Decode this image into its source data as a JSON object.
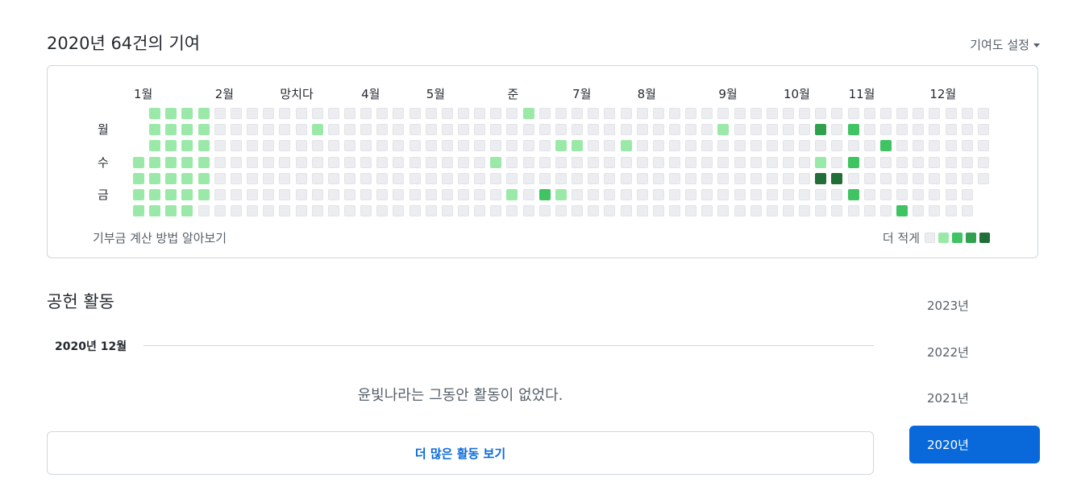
{
  "header": {
    "title": "2020년 64건의 기여",
    "settings_label": "기여도 설정"
  },
  "graph": {
    "months": [
      {
        "label": "1월",
        "col": 0
      },
      {
        "label": "2월",
        "col": 5
      },
      {
        "label": "망치다",
        "col": 9
      },
      {
        "label": "4월",
        "col": 14
      },
      {
        "label": "5월",
        "col": 18
      },
      {
        "label": "준",
        "col": 23
      },
      {
        "label": "7월",
        "col": 27
      },
      {
        "label": "8월",
        "col": 31
      },
      {
        "label": "9월",
        "col": 36
      },
      {
        "label": "10월",
        "col": 40
      },
      {
        "label": "11월",
        "col": 44
      },
      {
        "label": "12월",
        "col": 49
      }
    ],
    "weekdays": [
      {
        "label": "월",
        "row": 1
      },
      {
        "label": "수",
        "row": 3
      },
      {
        "label": "금",
        "row": 5
      }
    ],
    "weeks": 53,
    "first_week_start_row": 3,
    "last_week_end_row": 4,
    "active_cells": [
      [
        0,
        3,
        1
      ],
      [
        0,
        4,
        1
      ],
      [
        0,
        5,
        1
      ],
      [
        0,
        6,
        1
      ],
      [
        1,
        0,
        1
      ],
      [
        1,
        1,
        1
      ],
      [
        1,
        2,
        1
      ],
      [
        1,
        3,
        1
      ],
      [
        1,
        4,
        1
      ],
      [
        1,
        5,
        1
      ],
      [
        1,
        6,
        1
      ],
      [
        2,
        0,
        1
      ],
      [
        2,
        1,
        1
      ],
      [
        2,
        2,
        1
      ],
      [
        2,
        3,
        1
      ],
      [
        2,
        4,
        1
      ],
      [
        2,
        5,
        1
      ],
      [
        2,
        6,
        1
      ],
      [
        3,
        0,
        1
      ],
      [
        3,
        1,
        1
      ],
      [
        3,
        2,
        1
      ],
      [
        3,
        3,
        1
      ],
      [
        3,
        4,
        1
      ],
      [
        3,
        5,
        1
      ],
      [
        3,
        6,
        1
      ],
      [
        4,
        0,
        1
      ],
      [
        4,
        1,
        1
      ],
      [
        4,
        2,
        1
      ],
      [
        4,
        3,
        1
      ],
      [
        4,
        4,
        1
      ],
      [
        4,
        5,
        1
      ],
      [
        11,
        1,
        1
      ],
      [
        22,
        3,
        1
      ],
      [
        23,
        5,
        1
      ],
      [
        24,
        0,
        1
      ],
      [
        25,
        5,
        2
      ],
      [
        26,
        2,
        1
      ],
      [
        26,
        5,
        1
      ],
      [
        27,
        2,
        1
      ],
      [
        30,
        2,
        1
      ],
      [
        36,
        1,
        1
      ],
      [
        42,
        1,
        3
      ],
      [
        42,
        3,
        1
      ],
      [
        42,
        4,
        4
      ],
      [
        43,
        4,
        4
      ],
      [
        44,
        1,
        2
      ],
      [
        44,
        3,
        2
      ],
      [
        44,
        5,
        2
      ],
      [
        46,
        2,
        2
      ],
      [
        47,
        6,
        2
      ]
    ],
    "learn_link": "기부금 계산 방법 알아보기",
    "legend": {
      "less_label": "더 적게",
      "colors": [
        "#ebedf0",
        "#9be9a8",
        "#40c463",
        "#30a14e",
        "#216e39"
      ]
    }
  },
  "activity": {
    "title": "공헌 활동",
    "month_heading": "2020년 12월",
    "empty_message": "윤빛나라는 그동안 활동이 없었다.",
    "more_button": "더 많은 활동 보기"
  },
  "years": [
    {
      "label": "2023년",
      "active": false
    },
    {
      "label": "2022년",
      "active": false
    },
    {
      "label": "2021년",
      "active": false
    },
    {
      "label": "2020년",
      "active": true
    }
  ]
}
